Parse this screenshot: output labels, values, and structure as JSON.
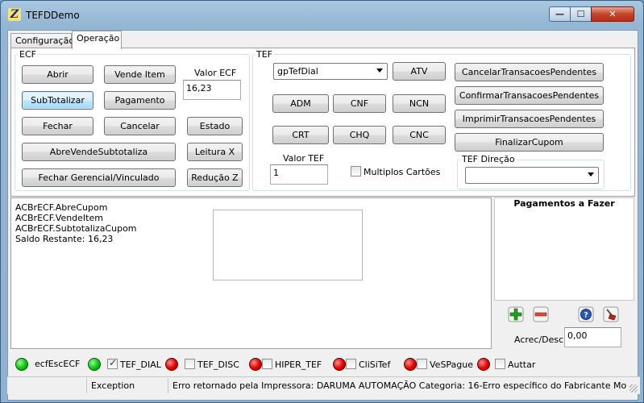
{
  "window": {
    "title": "TEFDDemo",
    "app_icon_glyph": "Z",
    "minimize_glyph": "—",
    "maximize_glyph": "☐",
    "close_glyph": "✕"
  },
  "tabs": [
    {
      "label": "Configuração",
      "active": false
    },
    {
      "label": "Operação",
      "active": true
    }
  ],
  "ecf": {
    "group_label": "ECF",
    "buttons": {
      "abrir": "Abrir",
      "vende_item": "Vende Item",
      "subtotalizar": "SubTotalizar",
      "pagamento": "Pagamento",
      "fechar": "Fechar",
      "cancelar": "Cancelar",
      "estado": "Estado",
      "abre_vende_subtotaliza": "AbreVendeSubtotaliza",
      "leitura_x": "Leitura X",
      "fechar_gerencial": "Fechar Gerencial/Vinculado",
      "reducao_z": "Redução Z"
    },
    "valor_label": "Valor ECF",
    "valor_value": "16,23"
  },
  "tef": {
    "group_label": "TEF",
    "gp_select_value": "gpTefDial",
    "buttons": {
      "atv": "ATV",
      "adm": "ADM",
      "cnf": "CNF",
      "ncn": "NCN",
      "crt": "CRT",
      "chq": "CHQ",
      "cnc": "CNC",
      "cancelar_pendentes": "CancelarTransacoesPendentes",
      "confirmar_pendentes": "ConfirmarTransacoesPendentes",
      "imprimir_pendentes": "ImprimirTransacoesPendentes",
      "finalizar_cupom": "FinalizarCupom"
    },
    "valor_label": "Valor TEF",
    "valor_value": "1",
    "multiplos_label": "Multiplos Cartões",
    "multiplos_checked": false,
    "direcao_label": "TEF Direção",
    "direcao_value": ""
  },
  "log": {
    "lines": [
      "ACBrECF.AbreCupom",
      "ACBrECF.VendeItem",
      "ACBrECF.SubtotalizaCupom",
      "Saldo Restante: 16,23"
    ]
  },
  "pagamentos": {
    "title": "Pagamentos a Fazer",
    "items": [],
    "add_icon": "plus-icon",
    "remove_icon": "minus-icon",
    "help_icon": "help-icon",
    "broom_icon": "broom-icon",
    "acrec_label": "Acrec/Desc",
    "acrec_value": "0,00"
  },
  "status_indicators": [
    {
      "label": "ecfEscECF",
      "state": "green",
      "has_checkbox": false,
      "checked": false
    },
    {
      "label": "TEF_DIAL",
      "state": "green",
      "has_checkbox": true,
      "checked": true
    },
    {
      "label": "TEF_DISC",
      "state": "red",
      "has_checkbox": true,
      "checked": false
    },
    {
      "label": "HIPER_TEF",
      "state": "red",
      "has_checkbox": true,
      "checked": false
    },
    {
      "label": "CliSiTef",
      "state": "red",
      "has_checkbox": true,
      "checked": false
    },
    {
      "label": "VeSPague",
      "state": "red",
      "has_checkbox": true,
      "checked": false
    },
    {
      "label": "Auttar",
      "state": "red",
      "has_checkbox": true,
      "checked": false
    }
  ],
  "statusbar": {
    "panel1": "",
    "panel2": "Exception",
    "panel3": "Erro retornado pela Impressora: DARUMA AUTOMAÇÃO  Categoria: 16-Erro específico do Fabricante Mo"
  },
  "colors": {
    "led_green": "#12c012",
    "led_red": "#e00000",
    "close_button": "#c7432a",
    "focus_button": "#bee6fd"
  }
}
